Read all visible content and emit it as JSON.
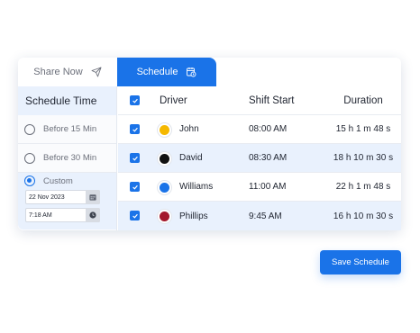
{
  "tabs": {
    "share": {
      "label": "Share Now",
      "icon": "send-icon"
    },
    "schedule": {
      "label": "Schedule",
      "icon": "calendar-clock-icon"
    }
  },
  "schedule_time": {
    "title": "Schedule Time",
    "options": [
      {
        "label": "Before 15 Min",
        "selected": false
      },
      {
        "label": "Before 30 Min",
        "selected": false
      },
      {
        "label": "Custom",
        "selected": true
      }
    ],
    "custom": {
      "date": "22 Nov 2023",
      "time": "7:18 AM"
    }
  },
  "table": {
    "headers": {
      "driver": "Driver",
      "shift_start": "Shift Start",
      "duration": "Duration"
    },
    "rows": [
      {
        "name": "John",
        "color": "#f5b800",
        "shift_start": "08:00 AM",
        "duration": "15 h 1 m 48 s"
      },
      {
        "name": "David",
        "color": "#111111",
        "shift_start": "08:30 AM",
        "duration": "18 h 10 m 30 s"
      },
      {
        "name": "Williams",
        "color": "#1a73e8",
        "shift_start": "11:00 AM",
        "duration": "22 h 1 m 48 s"
      },
      {
        "name": "Phillips",
        "color": "#a3182c",
        "shift_start": "9:45 AM",
        "duration": "16 h 10 m 30 s"
      }
    ]
  },
  "save_button": "Save Schedule",
  "colors": {
    "accent": "#1a73e8",
    "highlight": "#e9f1fd"
  }
}
